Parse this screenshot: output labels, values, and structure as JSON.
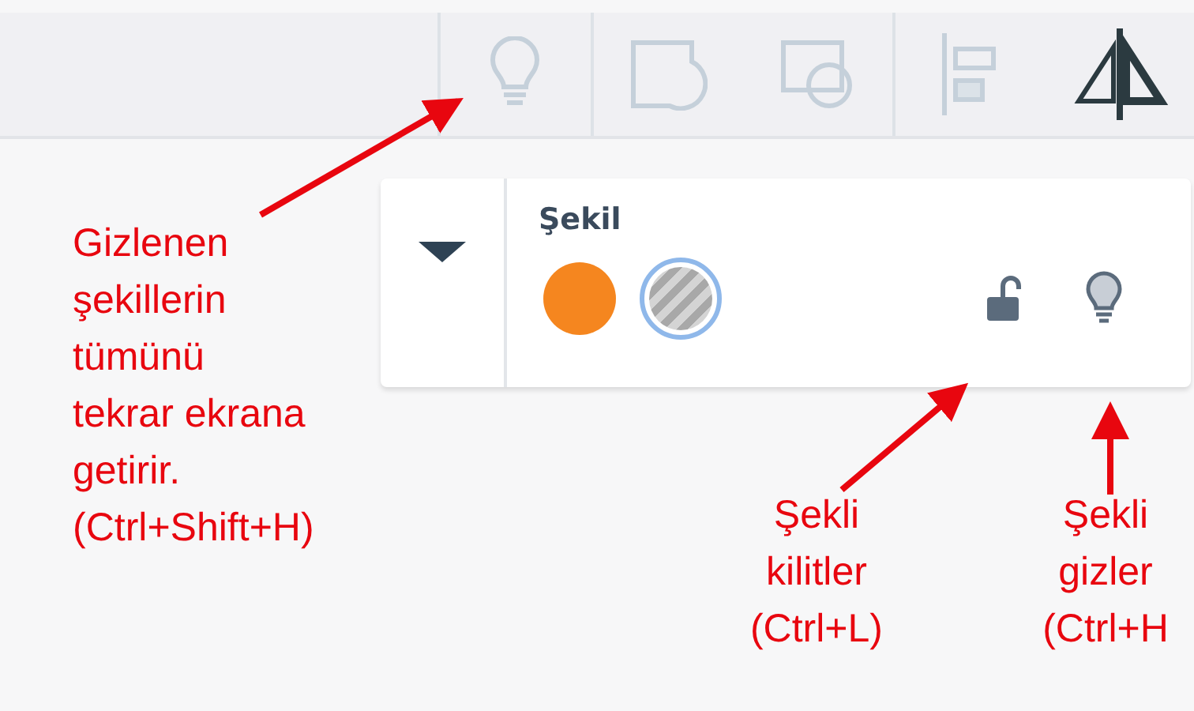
{
  "panel": {
    "title": "Şekil",
    "collapsed": false,
    "swatches": [
      {
        "kind": "fill",
        "color": "#f5861f",
        "selected": false
      },
      {
        "kind": "pattern",
        "color": "#a8a8a8",
        "selected": true
      }
    ],
    "locked": false,
    "hidden": false
  },
  "annotations": [
    {
      "text": "Gizlenen\nşekillerin\ntümünü\ntekrar ekrana\ngetirir.\n(Ctrl+Shift+H)"
    },
    {
      "text": "Şekli\nkilitler\n(Ctrl+L)"
    },
    {
      "text": "Şekli\ngizler\n(Ctrl+H"
    }
  ]
}
